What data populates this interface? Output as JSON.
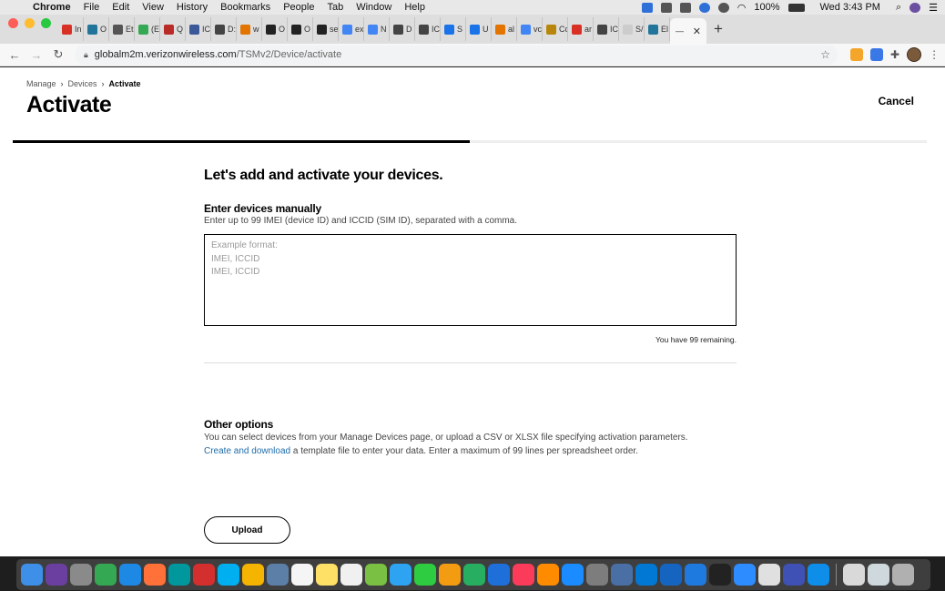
{
  "menubar": {
    "app_name": "Chrome",
    "items": [
      "File",
      "Edit",
      "View",
      "History",
      "Bookmarks",
      "People",
      "Tab",
      "Window",
      "Help"
    ],
    "battery": "100%",
    "clock": "Wed 3:43 PM"
  },
  "tabs": [
    {
      "label": "In",
      "icon": "gmail-icon",
      "color": "#d93025"
    },
    {
      "label": "O",
      "icon": "wordpress-icon",
      "color": "#21759b"
    },
    {
      "label": "Et",
      "icon": "image-icon",
      "color": "#555555"
    },
    {
      "label": "(E",
      "icon": "check-icon",
      "color": "#34a853"
    },
    {
      "label": "Q",
      "icon": "quora-icon",
      "color": "#b92b27"
    },
    {
      "label": "IC",
      "icon": "settings-icon",
      "color": "#3b5998"
    },
    {
      "label": "D:",
      "icon": "globe-icon",
      "color": "#444444"
    },
    {
      "label": "w",
      "icon": "chart-icon",
      "color": "#e37400"
    },
    {
      "label": "O",
      "icon": "github-icon",
      "color": "#222222"
    },
    {
      "label": "O",
      "icon": "github-icon",
      "color": "#222222"
    },
    {
      "label": "se",
      "icon": "github-icon",
      "color": "#222222"
    },
    {
      "label": "ex",
      "icon": "google-icon",
      "color": "#4285f4"
    },
    {
      "label": "N",
      "icon": "google-icon",
      "color": "#4285f4"
    },
    {
      "label": "D",
      "icon": "globe-icon",
      "color": "#444444"
    },
    {
      "label": "IC",
      "icon": "globe-icon",
      "color": "#444444"
    },
    {
      "label": "S",
      "icon": "analytics-icon",
      "color": "#1a73e8"
    },
    {
      "label": "U",
      "icon": "analytics-icon",
      "color": "#1a73e8"
    },
    {
      "label": "al",
      "icon": "feather-icon",
      "color": "#e37400"
    },
    {
      "label": "vc",
      "icon": "google-icon",
      "color": "#4285f4"
    },
    {
      "label": "Cc",
      "icon": "puzzle-icon",
      "color": "#b8860b"
    },
    {
      "label": "ar",
      "icon": "slash-icon",
      "color": "#d93025"
    },
    {
      "label": "IC",
      "icon": "globe-icon",
      "color": "#444444"
    },
    {
      "label": "S/",
      "icon": "blank-icon",
      "color": "#cccccc"
    },
    {
      "label": "El",
      "icon": "wordpress-icon",
      "color": "#21759b"
    }
  ],
  "active_tab": {
    "label": "—",
    "close": "✕"
  },
  "new_tab": "+",
  "address": {
    "domain": "globalm2m.verizonwireless.com",
    "path": "/TSMv2/Device/activate"
  },
  "page": {
    "breadcrumb": [
      "Manage",
      "Devices",
      "Activate"
    ],
    "title": "Activate",
    "cancel": "Cancel",
    "progress_fraction": 0.5,
    "headline": "Let's add and activate your devices.",
    "manual_title": "Enter devices manually",
    "manual_desc": "Enter up to 99 IMEI (device ID) and ICCID (SIM ID), separated with a comma.",
    "textarea_placeholder": "Example format:\nIMEI, ICCID\nIMEI, ICCID",
    "remaining": "You have 99 remaining.",
    "other_title": "Other options",
    "other_desc_line1": "You can select devices from your Manage Devices page, or upload a CSV or XLSX file specifying activation parameters.",
    "other_link": "Create and download",
    "other_desc_line2": " a template file to enter your data. Enter a maximum of 99 lines per spreadsheet order.",
    "upload": "Upload"
  },
  "dock": [
    {
      "icon": "finder-icon",
      "color": "#3d8fe8"
    },
    {
      "icon": "siri-icon",
      "color": "#6b3fa0"
    },
    {
      "icon": "launchpad-icon",
      "color": "#8a8a8a"
    },
    {
      "icon": "chrome-icon",
      "color": "#34a853"
    },
    {
      "icon": "safari-icon",
      "color": "#1e88e5"
    },
    {
      "icon": "firefox-icon",
      "color": "#ff7139"
    },
    {
      "icon": "arduino-icon",
      "color": "#00979d"
    },
    {
      "icon": "app-red-icon",
      "color": "#d32f2f"
    },
    {
      "icon": "skype-icon",
      "color": "#00aff0"
    },
    {
      "icon": "photos-icon",
      "color": "#f4b400"
    },
    {
      "icon": "preview-icon",
      "color": "#5b7fa6"
    },
    {
      "icon": "calendar-icon",
      "color": "#f5f5f5"
    },
    {
      "icon": "notes-icon",
      "color": "#ffe066"
    },
    {
      "icon": "reminders-icon",
      "color": "#f0f0f0"
    },
    {
      "icon": "maps-icon",
      "color": "#7ac143"
    },
    {
      "icon": "messages-icon",
      "color": "#2ea3f2"
    },
    {
      "icon": "facetime-icon",
      "color": "#2ecc40"
    },
    {
      "icon": "pages-icon",
      "color": "#f39c12"
    },
    {
      "icon": "numbers-icon",
      "color": "#27ae60"
    },
    {
      "icon": "keynote-icon",
      "color": "#1e6fd9"
    },
    {
      "icon": "music-icon",
      "color": "#fa3c5a"
    },
    {
      "icon": "books-icon",
      "color": "#ff8c00"
    },
    {
      "icon": "appstore-icon",
      "color": "#1a8cff"
    },
    {
      "icon": "system-preferences-icon",
      "color": "#7d7d7d"
    },
    {
      "icon": "network-icon",
      "color": "#4a6fa5"
    },
    {
      "icon": "skype-business-icon",
      "color": "#0078d4"
    },
    {
      "icon": "jlink-icon",
      "color": "#1565c0"
    },
    {
      "icon": "ide-icon",
      "color": "#1f7ae0"
    },
    {
      "icon": "terminal-icon",
      "color": "#222222"
    },
    {
      "icon": "zoom-icon",
      "color": "#2d8cff"
    },
    {
      "icon": "document-icon",
      "color": "#e0e0e0"
    },
    {
      "icon": "chart-app-icon",
      "color": "#3f51b5"
    },
    {
      "icon": "teamviewer-icon",
      "color": "#0e8ee9"
    },
    {
      "icon": "window-icon",
      "color": "#d9d9d9"
    },
    {
      "icon": "screenshot-icon",
      "color": "#cfd8dc"
    },
    {
      "icon": "trash-icon",
      "color": "#b0b0b0"
    }
  ]
}
